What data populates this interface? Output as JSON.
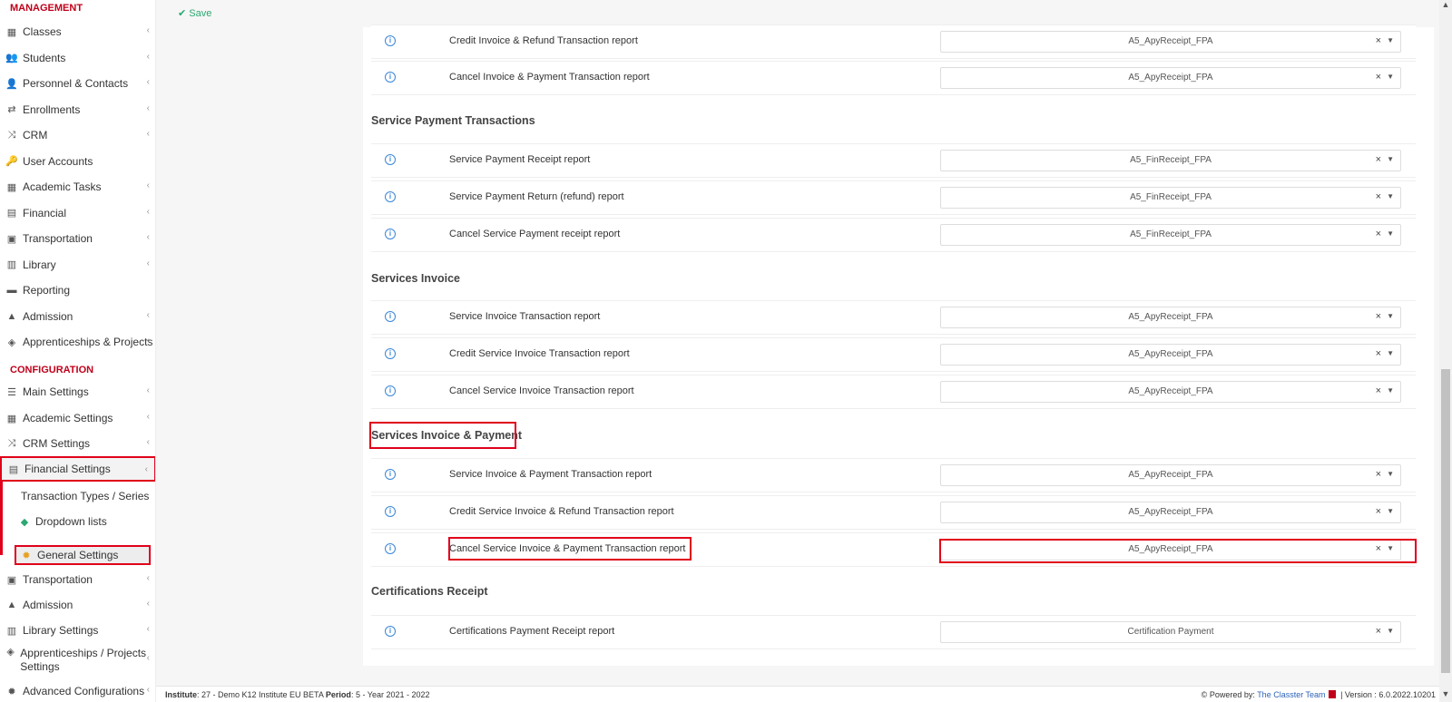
{
  "toolbar": {
    "save_label": "Save"
  },
  "sidebar": {
    "management_heading": "MANAGEMENT",
    "configuration_heading": "CONFIGURATION",
    "management_items": [
      {
        "label": "Classes",
        "icon": "classes-icon"
      },
      {
        "label": "Students",
        "icon": "students-icon"
      },
      {
        "label": "Personnel & Contacts",
        "icon": "personnel-icon"
      },
      {
        "label": "Enrollments",
        "icon": "enrollments-icon"
      },
      {
        "label": "CRM",
        "icon": "crm-icon"
      },
      {
        "label": "User Accounts",
        "icon": "user-accounts-icon"
      },
      {
        "label": "Academic Tasks",
        "icon": "academic-tasks-icon"
      },
      {
        "label": "Financial",
        "icon": "financial-icon"
      },
      {
        "label": "Transportation",
        "icon": "bus-icon"
      },
      {
        "label": "Library",
        "icon": "library-icon"
      },
      {
        "label": "Reporting",
        "icon": "printer-icon"
      },
      {
        "label": "Admission",
        "icon": "admission-icon"
      },
      {
        "label": "Apprenticeships & Projects",
        "icon": "box-icon"
      }
    ],
    "configuration_items": [
      {
        "label": "Main Settings",
        "icon": "sliders-icon"
      },
      {
        "label": "Academic Settings",
        "icon": "classes-icon"
      },
      {
        "label": "CRM Settings",
        "icon": "crm-icon"
      },
      {
        "label": "Financial Settings",
        "icon": "financial-icon"
      }
    ],
    "financial_sub": [
      {
        "label": "Transaction Types / Series"
      },
      {
        "label": "Dropdown lists",
        "icon": "layers-icon"
      },
      {
        "label": "General Settings",
        "icon": "gear-icon"
      }
    ],
    "configuration_items_after": [
      {
        "label": "Transportation",
        "icon": "bus-icon"
      },
      {
        "label": "Admission",
        "icon": "admission-icon"
      },
      {
        "label": "Library Settings",
        "icon": "library-icon"
      },
      {
        "label": "Apprenticeships / Projects Settings",
        "icon": "box-icon"
      },
      {
        "label": "Advanced Configurations",
        "icon": "gears-icon"
      }
    ]
  },
  "content": {
    "top_rows": [
      {
        "label": "Credit Invoice & Refund Transaction report",
        "value": "A5_ApyReceipt_FPA"
      },
      {
        "label": "Cancel Invoice & Payment Transaction report",
        "value": "A5_ApyReceipt_FPA"
      }
    ],
    "groups": [
      {
        "title": "Service Payment Transactions",
        "rows": [
          {
            "label": "Service Payment Receipt report",
            "value": "A5_FinReceipt_FPA"
          },
          {
            "label": "Service Payment Return (refund) report",
            "value": "A5_FinReceipt_FPA"
          },
          {
            "label": "Cancel Service Payment receipt report",
            "value": "A5_FinReceipt_FPA"
          }
        ]
      },
      {
        "title": "Services Invoice",
        "rows": [
          {
            "label": "Service Invoice Transaction report",
            "value": "A5_ApyReceipt_FPA"
          },
          {
            "label": "Credit Service Invoice Transaction report",
            "value": "A5_ApyReceipt_FPA"
          },
          {
            "label": "Cancel Service Invoice Transaction report",
            "value": "A5_ApyReceipt_FPA"
          }
        ]
      },
      {
        "title": "Services Invoice & Payment",
        "rows": [
          {
            "label": "Service Invoice & Payment Transaction report",
            "value": "A5_ApyReceipt_FPA"
          },
          {
            "label": "Credit Service Invoice & Refund Transaction report",
            "value": "A5_ApyReceipt_FPA"
          },
          {
            "label": "Cancel Service Invoice & Payment Transaction report",
            "value": "A5_ApyReceipt_FPA"
          }
        ]
      },
      {
        "title": "Certifications Receipt",
        "rows": [
          {
            "label": "Certifications Payment Receipt report",
            "value": "Certification Payment"
          }
        ]
      }
    ],
    "clear_glyph": "×",
    "info_glyph": "i"
  },
  "footer": {
    "institute_label": "Institute",
    "institute_value": ": 27 - Demo K12 Institute EU BETA",
    "period_label": "Period",
    "period_value": ": 5 - Year 2021 - 2022",
    "powered_by": "Powered by:",
    "team": "The Classter Team",
    "version": "| Version : 6.0.2022.10201"
  },
  "colors": {
    "accent_red": "#e0001a",
    "save_green": "#2aa870",
    "info_blue": "#3a86d9"
  }
}
